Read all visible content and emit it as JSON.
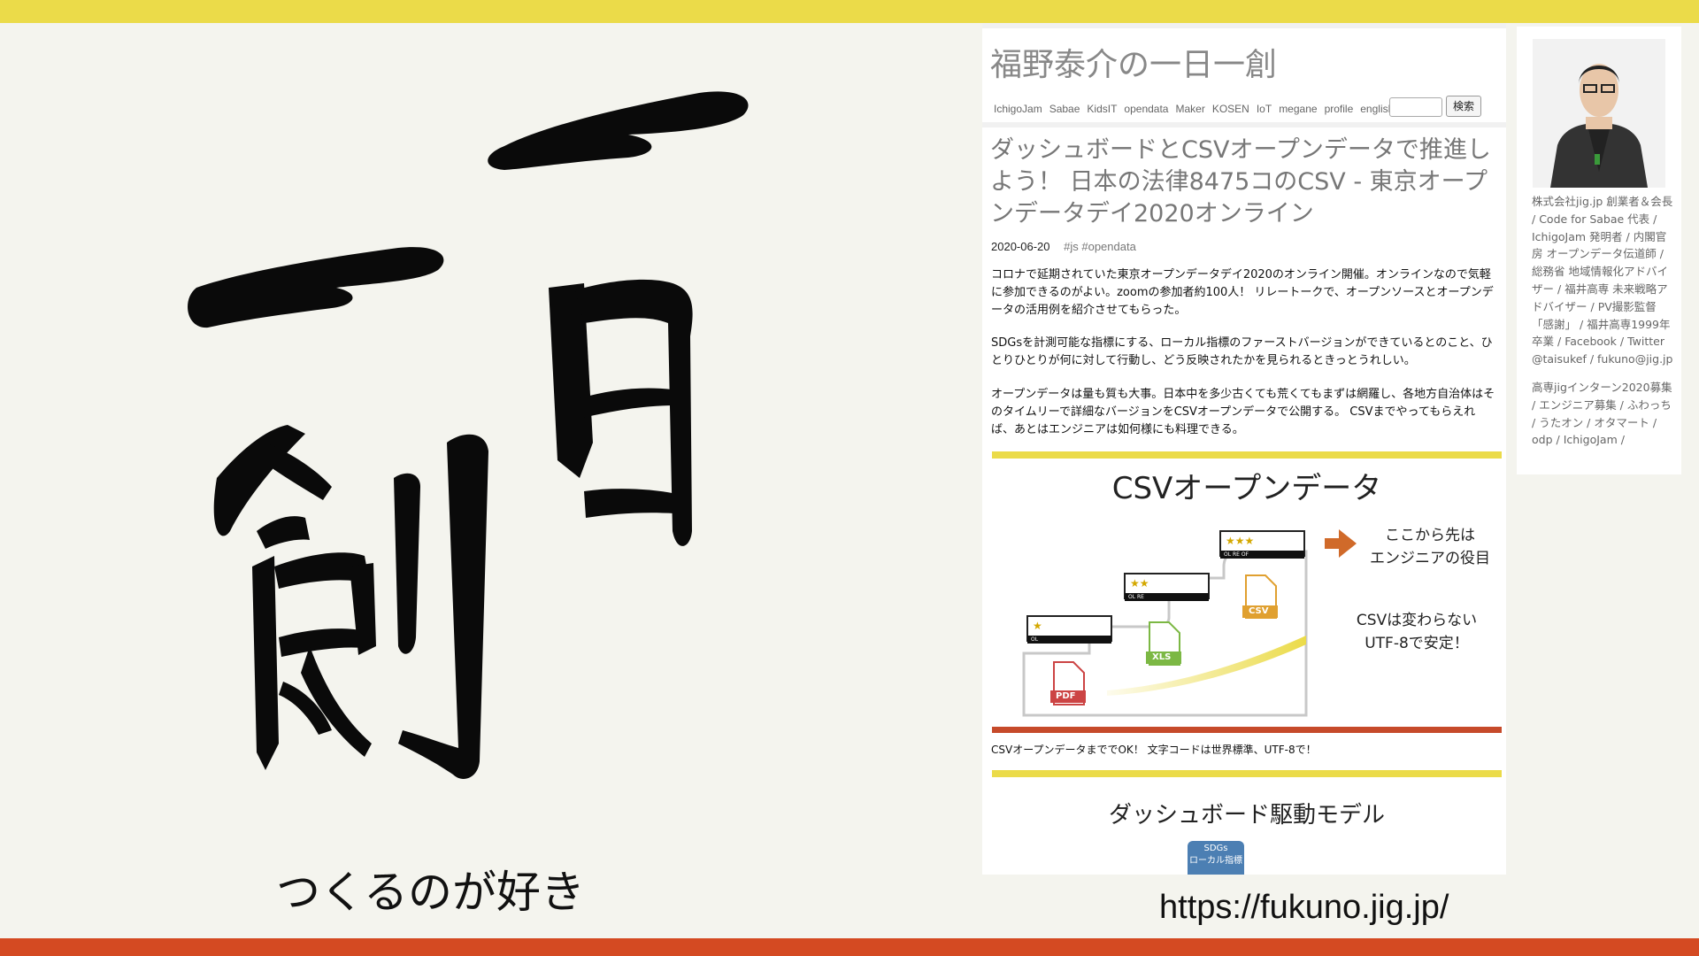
{
  "slide": {
    "caption": "つくるのが好き",
    "url": "https://fukuno.jig.jp/",
    "calligraphy_text": "一日一創",
    "colors": {
      "top_bar": "#ebdb49",
      "bottom_bar": "#d44a22",
      "background": "#f4f4ee"
    }
  },
  "blog": {
    "site_title": "福野泰介の一日一創",
    "nav": [
      "IchigoJam",
      "Sabae",
      "KidsIT",
      "opendata",
      "Maker",
      "KOSEN",
      "IoT",
      "megane",
      "profile",
      "english"
    ],
    "search_value": "",
    "search_button": "検索",
    "article": {
      "title": "ダッシュボードとCSVオープンデータで推進しよう！ 日本の法律8475コのCSV - 東京オープンデータデイ2020オンライン",
      "date": "2020-06-20",
      "tags": "#js #opendata",
      "paragraphs": [
        "コロナで延期されていた東京オープンデータデイ2020のオンライン開催。オンラインなので気軽に参加できるのがよい。zoomの参加者約100人！ リレートークで、オープンソースとオープンデータの活用例を紹介させてもらった。",
        "SDGsを計測可能な指標にする、ローカル指標のファーストバージョンができているとのこと、ひとりひとりが何に対して行動し、どう反映されたかを見られるときっとうれしい。",
        "オープンデータは量も質も大事。日本中を多少古くても荒くてもまずは網羅し、各地方自治体はそのタイムリーで詳細なバージョンをCSVオープンデータで公開する。 CSVまでやってもらえれば、あとはエンジニアは如何様にも料理できる。"
      ],
      "slide1": {
        "title": "CSVオープンデータ",
        "arrow_text_1": "ここから先は",
        "arrow_text_2": "エンジニアの役目",
        "note_1": "CSVは変わらない",
        "note_2": "UTF-8で安定！",
        "steps": [
          {
            "stars": "★",
            "label": "OL",
            "file": "PDF"
          },
          {
            "stars": "★★",
            "label": "OL  RE",
            "file": "XLS"
          },
          {
            "stars": "★★★",
            "label": "OL  RE  OF",
            "file": "CSV"
          }
        ]
      },
      "slide1_caption": "CSVオープンデータまででOK！ 文字コードは世界標準、UTF-8で！",
      "slide2": {
        "title": "ダッシュボード駆動モデル",
        "badge_1": "SDGs",
        "badge_2": "ローカル指標"
      }
    },
    "sidebar": {
      "bio_items": [
        "株式会社jig.jp 創業者＆会長",
        "Code for Sabae 代表",
        "IchigoJam 発明者",
        "内閣官房 オープンデータ伝道師",
        "総務省 地域情報化アドバイザー",
        "福井高専 未来戦略アドバイザー",
        "PV撮影監督「感謝」",
        "福井高専1999年卒業",
        "Facebook",
        "Twitter @taisukef",
        "fukuno@jig.jp"
      ],
      "link_items": [
        "高専jigインターン2020募集",
        "エンジニア募集",
        "ふわっち",
        "うたオン",
        "オタマート",
        "odp",
        "IchigoJam"
      ]
    }
  }
}
